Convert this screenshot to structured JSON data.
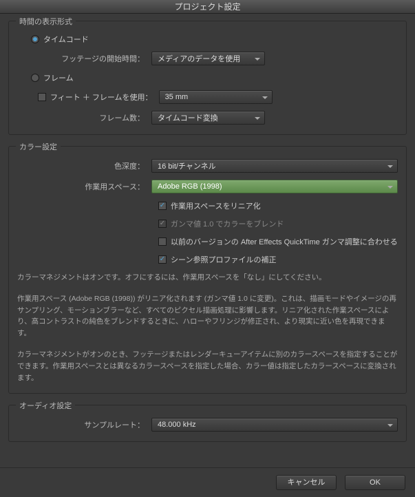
{
  "title": "プロジェクト設定",
  "time": {
    "group_label": "時間の表示形式",
    "radio_timecode": "タイムコード",
    "footage_start_label": "フッテージの開始時間：",
    "footage_start_value": "メディアのデータを使用",
    "radio_frames": "フレーム",
    "use_feet_frames": "フィート ＋ フレームを使用：",
    "feet_frames_value": "35 mm",
    "frame_count_label": "フレーム数：",
    "frame_count_value": "タイムコード変換"
  },
  "color": {
    "group_label": "カラー設定",
    "depth_label": "色深度：",
    "depth_value": "16 bit/チャンネル",
    "ws_label": "作業用スペース：",
    "ws_value": "Adobe RGB (1998)",
    "linearize": "作業用スペースをリニア化",
    "blend_gamma": "ガンマ値 1.0 でカラーをブレンド",
    "match_legacy": "以前のバージョンの After Effects QuickTime ガンマ調整に合わせる",
    "compensate": "シーン参照プロファイルの補正",
    "help1": "カラーマネジメントはオンです。オフにするには、作業用スペースを「なし」にしてください。",
    "help2": "作業用スペース (Adobe RGB (1998)) がリニア化されます (ガンマ値 1.0 に変更)。これは、描画モードやイメージの再サンプリング、モーションブラーなど、すべてのピクセル描画処理に影響します。リニア化された作業スペースにより、高コントラストの純色をブレンドするときに、ハローやフリンジが修正され、より現実に近い色を再現できます。",
    "help3": "カラーマネジメントがオンのとき、フッテージまたはレンダーキューアイテムに別のカラースペースを指定することができます。作業用スペースとは異なるカラースペースを指定した場合、カラー値は指定したカラースペースに変換されます。"
  },
  "audio": {
    "group_label": "オーディオ設定",
    "rate_label": "サンプルレート：",
    "rate_value": "48.000 kHz"
  },
  "footer": {
    "cancel": "キャンセル",
    "ok": "OK"
  }
}
